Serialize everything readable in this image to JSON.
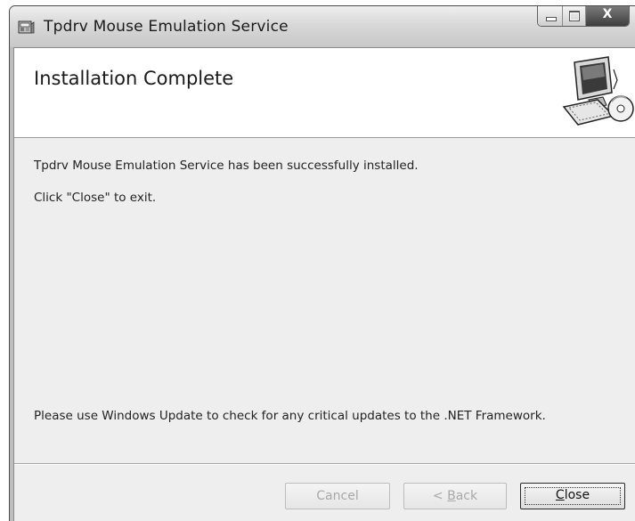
{
  "window": {
    "title": "Tpdrv Mouse Emulation Service",
    "caption_buttons": {
      "minimize_icon": "minimize-glyph",
      "maximize_icon": "maximize-glyph",
      "close_glyph": "X"
    }
  },
  "header": {
    "title": "Installation Complete",
    "art_icon": "computer-with-disc"
  },
  "body": {
    "line1": "Tpdrv Mouse Emulation Service has been successfully installed.",
    "line2": "Click \"Close\" to exit.",
    "line3": "Please use Windows Update to check for any critical updates to the .NET Framework."
  },
  "buttons": {
    "cancel": {
      "label": "Cancel",
      "enabled": false
    },
    "back": {
      "prefix": "< ",
      "mnemonic": "B",
      "rest": "ack",
      "enabled": false
    },
    "close": {
      "mnemonic": "C",
      "rest": "lose",
      "enabled": true,
      "default": true
    }
  }
}
